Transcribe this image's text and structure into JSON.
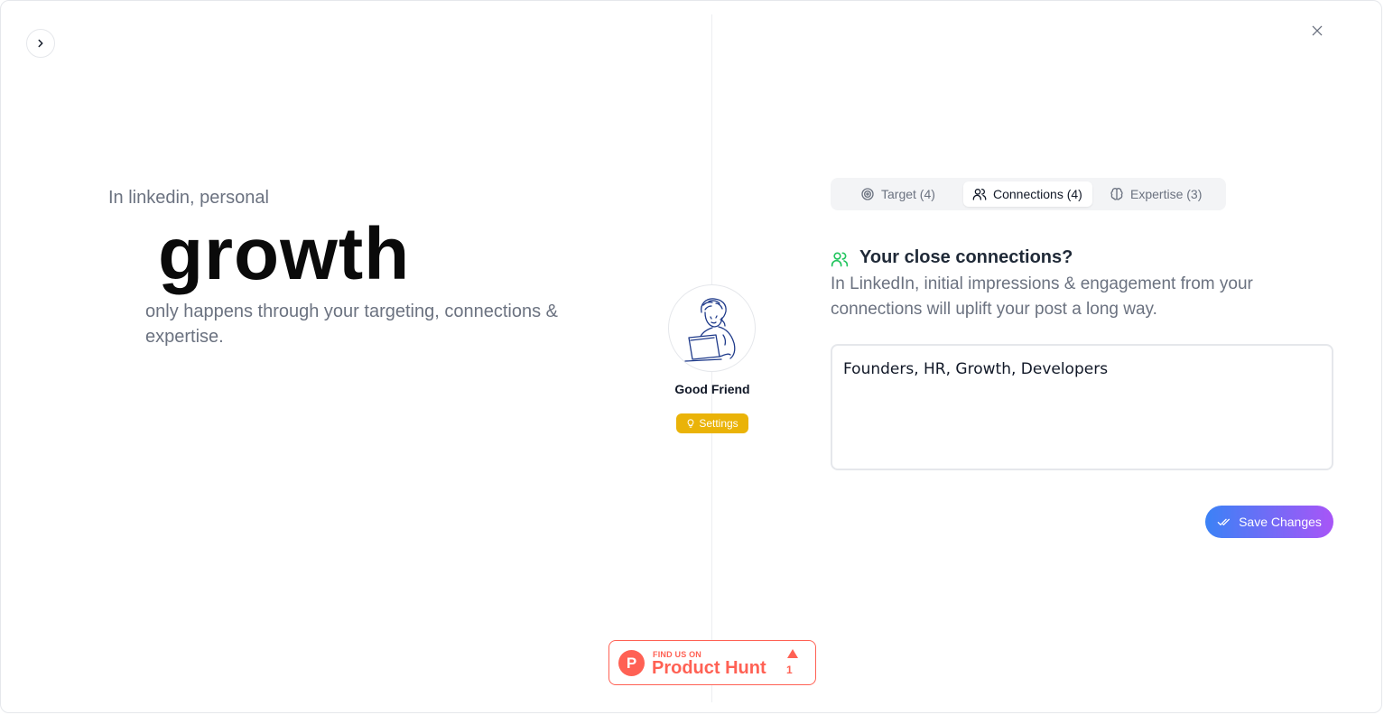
{
  "hero": {
    "intro": "In linkedin, personal",
    "big_word": "growth",
    "subtitle": "only happens through your targeting, connections & expertise."
  },
  "agent": {
    "name": "Good Friend",
    "settings_label": "Settings"
  },
  "tabs": [
    {
      "label": "Target (4)",
      "icon": "target-icon",
      "active": false
    },
    {
      "label": "Connections (4)",
      "icon": "users-icon",
      "active": true
    },
    {
      "label": "Expertise (3)",
      "icon": "brain-icon",
      "active": false
    }
  ],
  "question": {
    "title": "Your close connections?",
    "description": "In LinkedIn, initial impressions & engagement from your connections will uplift your post a long way.",
    "answer": "Founders, HR, Growth, Developers"
  },
  "save_label": "Save Changes",
  "product_hunt": {
    "small": "FIND US ON",
    "big": "Product Hunt",
    "count": "1"
  },
  "colors": {
    "accent_from": "#3b82f6",
    "accent_to": "#a855f7",
    "badge": "#eab308",
    "product_hunt": "#ff6154",
    "question_icon": "#22c55e"
  }
}
